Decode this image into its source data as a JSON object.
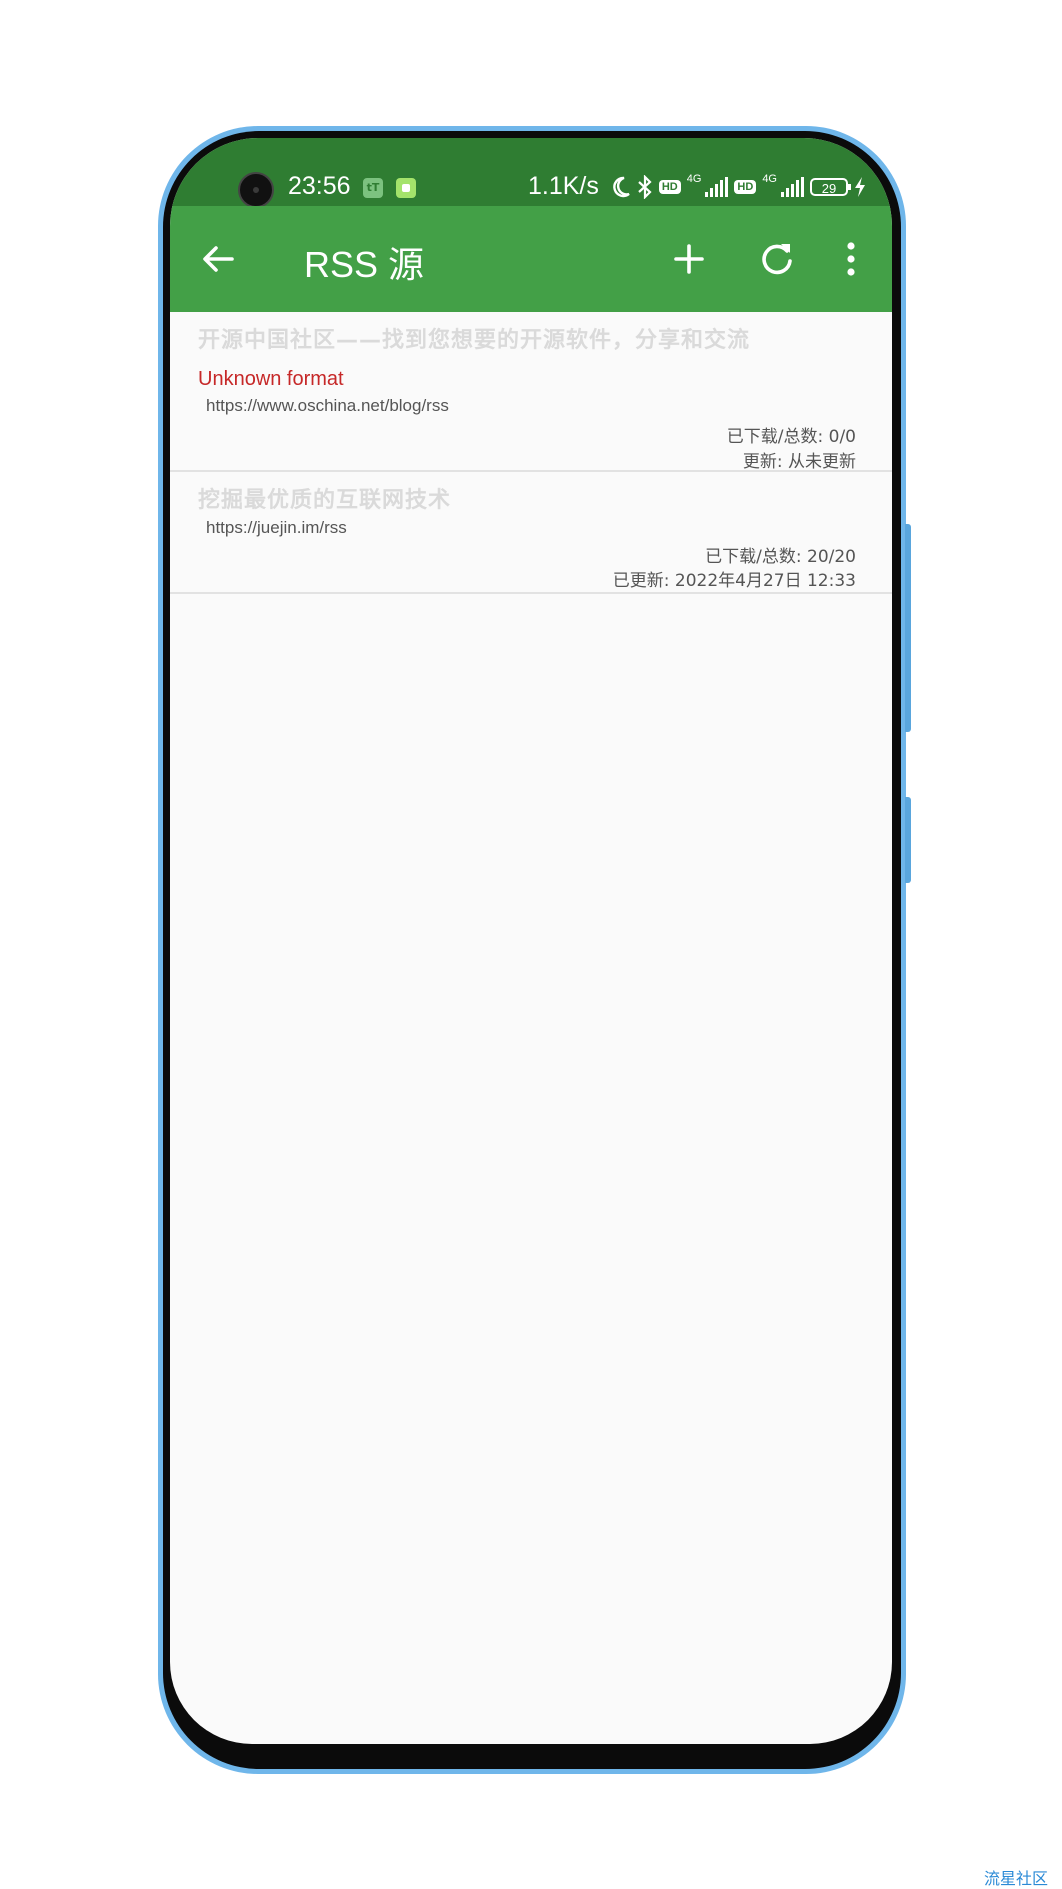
{
  "status_bar": {
    "time": "23:56",
    "notif_badge": "tT",
    "net_speed": "1.1K/s",
    "hd1": "HD",
    "net1": "4G",
    "hd2": "HD",
    "net2": "4G",
    "battery": "29"
  },
  "app_bar": {
    "title": "RSS 源"
  },
  "feeds": [
    {
      "title": "开源中国社区——找到您想要的开源软件，分享和交流",
      "error": "Unknown format",
      "url": "https://www.oschina.net/blog/rss",
      "count": "已下载/总数:   0/0",
      "updated": "更新: 从未更新"
    },
    {
      "title": "挖掘最优质的互联网技术",
      "url": "https://juejin.im/rss",
      "count": "已下载/总数:   20/20",
      "updated": "已更新: 2022年4月27日 12:33"
    }
  ],
  "watermark": "流星社区",
  "colors": {
    "status_bar": "#2f7d32",
    "app_bar": "#43a047",
    "error": "#c62828",
    "frame": "#6fb6ea"
  }
}
